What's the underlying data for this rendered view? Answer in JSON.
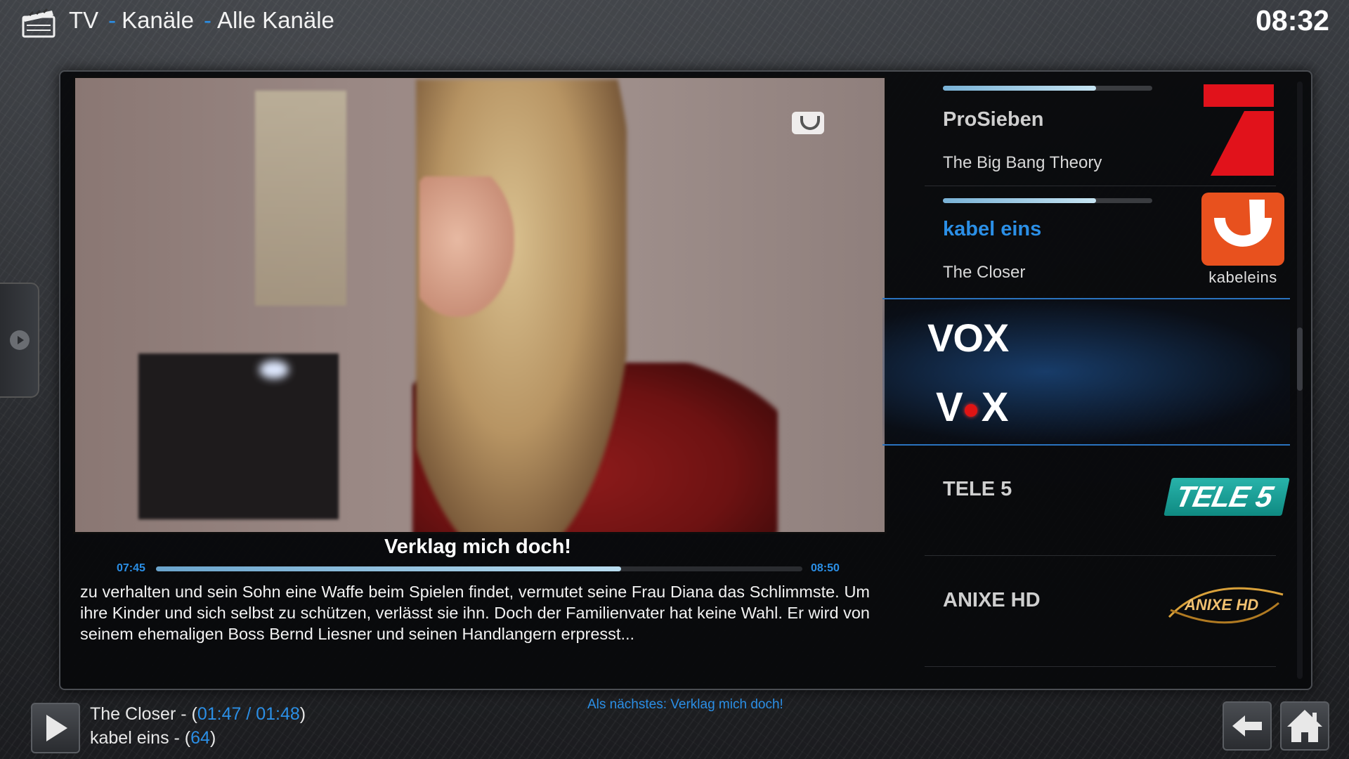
{
  "header": {
    "crumb1": "TV",
    "crumb2": "Kanäle",
    "crumb3": "Alle Kanäle",
    "sep": "-",
    "clock": "08:32"
  },
  "player": {
    "program_title": "Verklag mich doch!",
    "start_time": "07:45",
    "end_time": "08:50",
    "progress": 0.72,
    "plot": "zu verhalten und sein Sohn eine Waffe beim Spielen findet, vermutet seine Frau Diana das Schlimmste. Um ihre Kinder und sich selbst zu schützen, verlässt sie ihn. Doch der Familienvater hat keine Wahl. Er wird von seinem ehemaligen Boss Bernd Liesner und seinen Handlangern erpresst..."
  },
  "channels": [
    {
      "name": "ProSieben",
      "show": "The Big Bang Theory",
      "progress": 0.73,
      "logo_icon": "prosieben-logo"
    },
    {
      "name": "kabel eins",
      "show": "The Closer",
      "progress": 0.73,
      "logo_icon": "kabeleins-logo",
      "logo_text": "kabeleins"
    },
    {
      "name": "VOX",
      "show": "",
      "logo_icon": "vox-logo",
      "logo_text_v": "V",
      "logo_text_x": "X"
    },
    {
      "name": "TELE 5",
      "show": "",
      "logo_icon": "tele5-logo",
      "logo_text": "TELE 5"
    },
    {
      "name": "ANIXE HD",
      "show": "",
      "logo_icon": "anixe-logo",
      "logo_text": "ANIXE HD"
    }
  ],
  "now_playing": {
    "title": "The Closer",
    "dash1": " - (",
    "elapsed": "01:47 / 01:48",
    "close1": ")",
    "channel": "kabel eins",
    "dash2": " - (",
    "channel_number": "64",
    "close2": ")"
  },
  "next_up": "Als nächstes: Verklag mich doch!",
  "colors": {
    "accent": "#2b8fe6",
    "panel": "#08090b"
  }
}
